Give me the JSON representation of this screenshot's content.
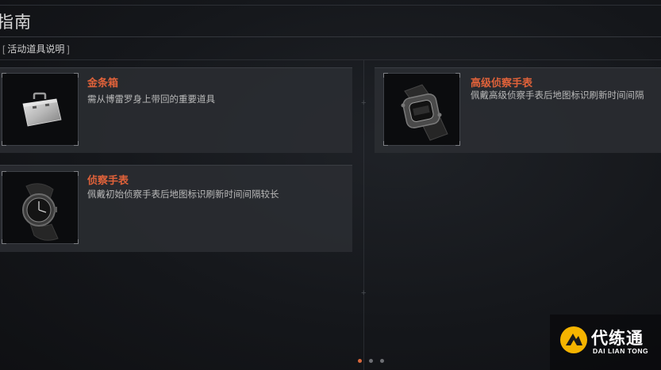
{
  "header": {
    "title": "指南",
    "section_label": "活动道具说明",
    "bracket_open": "[",
    "bracket_close": "]"
  },
  "items": [
    {
      "name": "金条箱",
      "description": "需从博雷罗身上带回的重要道具",
      "icon": "briefcase-icon"
    },
    {
      "name": "侦察手表",
      "description": "佩戴初始侦察手表后地图标识刷新时间间隔较长",
      "icon": "wristwatch-icon"
    },
    {
      "name": "高级侦察手表",
      "description": "佩戴高级侦察手表后地图标识刷新时间间隔",
      "icon": "rugged-watch-icon"
    }
  ],
  "pagination": {
    "total": 3,
    "active_index": 0
  },
  "watermark": {
    "name_cn": "代练通",
    "name_en": "DAI LIAN TONG"
  },
  "colors": {
    "accent": "#e0623a",
    "background": "#15171b",
    "card": "#2c2e33",
    "watermark_logo": "#f5b400"
  }
}
